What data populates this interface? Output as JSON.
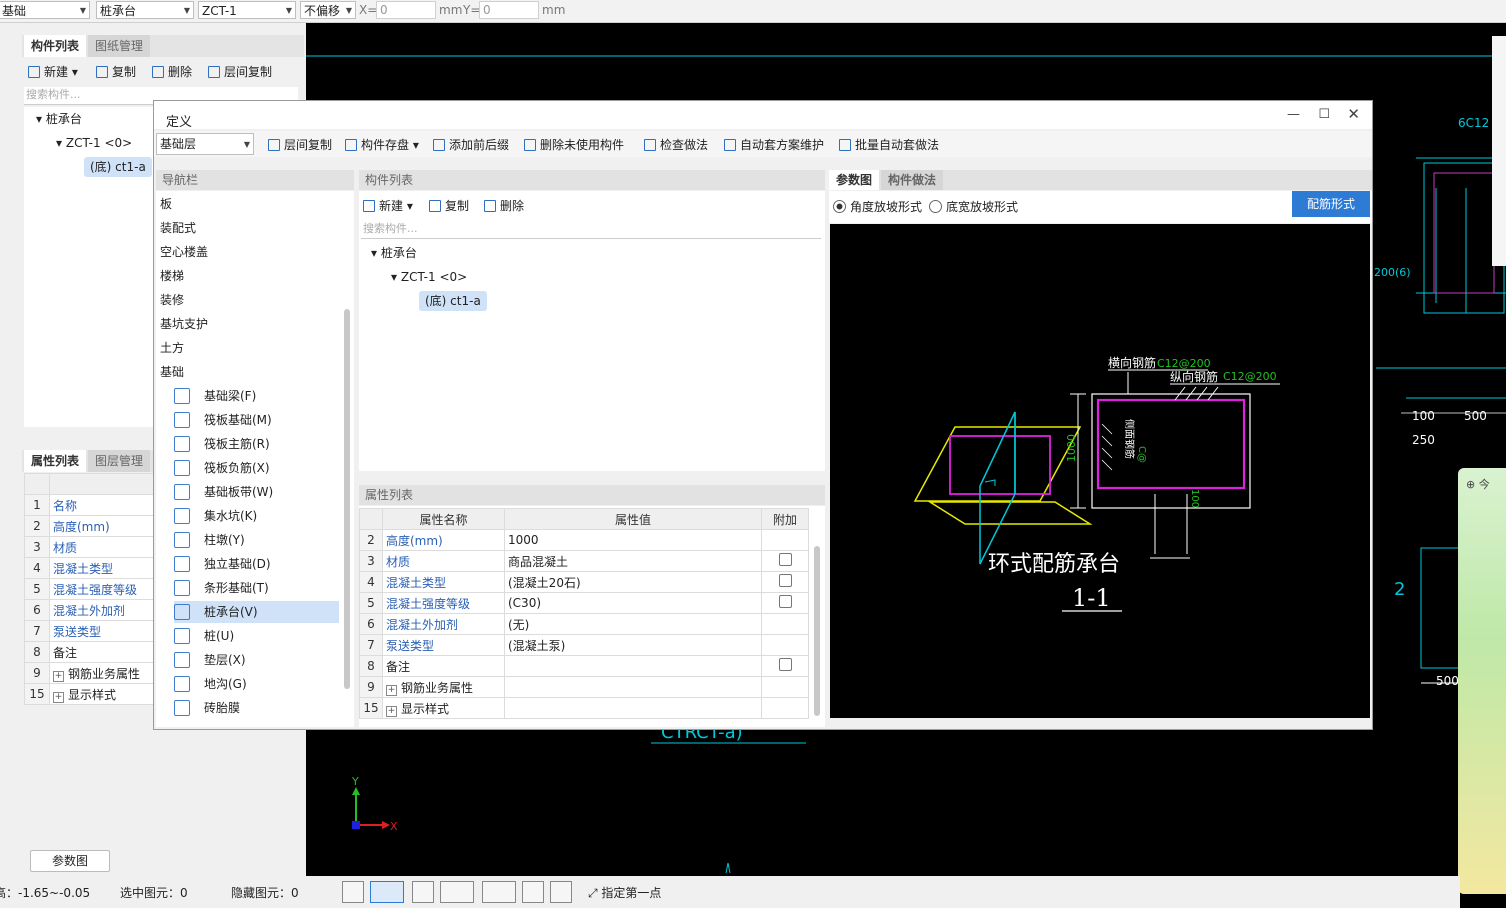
{
  "topbar": {
    "layer": "基础",
    "type": "桩承台",
    "component": "ZCT-1",
    "offset": "不偏移",
    "x_label": "X=",
    "x_value": "0",
    "unit1": "mm",
    "y_label": "Y=",
    "y_value": "0",
    "unit2": "mm"
  },
  "left": {
    "tabs": [
      "构件列表",
      "图纸管理"
    ],
    "toolbar": {
      "new": "新建",
      "copy": "复制",
      "delete": "删除",
      "floor_copy": "层间复制"
    },
    "search_placeholder": "搜索构件...",
    "tree": {
      "root": "桩承台",
      "child": "ZCT-1 <0>",
      "leaf": "(底) ct1-a"
    },
    "prop_tabs": [
      "属性列表",
      "图层管理"
    ],
    "prop_header": "属性名称",
    "props": [
      {
        "n": "1",
        "name": "名称"
      },
      {
        "n": "2",
        "name": "高度(mm)"
      },
      {
        "n": "3",
        "name": "材质"
      },
      {
        "n": "4",
        "name": "混凝土类型"
      },
      {
        "n": "5",
        "name": "混凝土强度等级"
      },
      {
        "n": "6",
        "name": "混凝土外加剂"
      },
      {
        "n": "7",
        "name": "泵送类型"
      },
      {
        "n": "8",
        "name": "备注"
      },
      {
        "n": "9",
        "name": "钢筋业务属性"
      },
      {
        "n": "15",
        "name": "显示样式"
      }
    ],
    "param_btn": "参数图"
  },
  "dialog": {
    "title": "定义",
    "layer_select": "基础层",
    "toolbar": [
      "层间复制",
      "构件存盘",
      "添加前后缀",
      "删除未使用构件",
      "检查做法",
      "自动套方案维护",
      "批量自动套做法"
    ],
    "nav_title": "导航栏",
    "nav_groups": [
      "板",
      "装配式",
      "空心楼盖",
      "楼梯",
      "装修",
      "基坑支护",
      "土方",
      "基础"
    ],
    "nav_items": [
      "基础梁(F)",
      "筏板基础(M)",
      "筏板主筋(R)",
      "筏板负筋(X)",
      "基础板带(W)",
      "集水坑(K)",
      "柱墩(Y)",
      "独立基础(D)",
      "条形基础(T)",
      "桩承台(V)",
      "桩(U)",
      "垫层(X)",
      "地沟(G)",
      "砖胎膜"
    ],
    "comp_title": "构件列表",
    "comp_toolbar": {
      "new": "新建",
      "copy": "复制",
      "delete": "删除"
    },
    "comp_search": "搜索构件...",
    "comp_tree": {
      "root": "桩承台",
      "child": "ZCT-1 <0>",
      "leaf": "(底) ct1-a"
    },
    "prop_title": "属性列表",
    "prop_headers": [
      "属性名称",
      "属性值",
      "附加"
    ],
    "props": [
      {
        "n": "2",
        "name": "高度(mm)",
        "value": "1000",
        "chk": false
      },
      {
        "n": "3",
        "name": "材质",
        "value": "商品混凝土",
        "chk": true
      },
      {
        "n": "4",
        "name": "混凝土类型",
        "value": "(混凝土20石)",
        "chk": true
      },
      {
        "n": "5",
        "name": "混凝土强度等级",
        "value": "(C30)",
        "chk": true
      },
      {
        "n": "6",
        "name": "混凝土外加剂",
        "value": "(无)",
        "chk": false
      },
      {
        "n": "7",
        "name": "泵送类型",
        "value": "(混凝土泵)",
        "chk": false
      },
      {
        "n": "8",
        "name": "备注",
        "value": "",
        "chk": true
      },
      {
        "n": "9",
        "name": "钢筋业务属性",
        "value": "",
        "chk": false
      },
      {
        "n": "15",
        "name": "显示样式",
        "value": "",
        "chk": false
      }
    ],
    "right_tabs": [
      "参数图",
      "构件做法"
    ],
    "radio1": "角度放坡形式",
    "radio2": "底宽放坡形式",
    "rebar_btn": "配筋形式",
    "drawing": {
      "label1": "横向钢筋",
      "val1": "C12@200",
      "label2": "纵向钢筋",
      "val2": "C12@200",
      "side": "侧面钢筋",
      "side_val": "C@",
      "dim": "1000",
      "dim2": "100",
      "title": "环式配筋承台",
      "section": "1-1"
    }
  },
  "status": {
    "elev": "高：-1.65~-0.05",
    "selected": "选中图元：0",
    "hidden": "隐藏图元：0",
    "hint": "指定第一点"
  },
  "cad": {
    "t1": "6C12",
    "t2": "200(6)",
    "t3": "100",
    "t4": "500",
    "t5": "250",
    "t6": "2",
    "t7": "500",
    "t8": "100"
  },
  "colors": {
    "accent": "#2e7bd6",
    "cad_cyan": "#00c8d8",
    "cad_magenta": "#e020e0"
  }
}
